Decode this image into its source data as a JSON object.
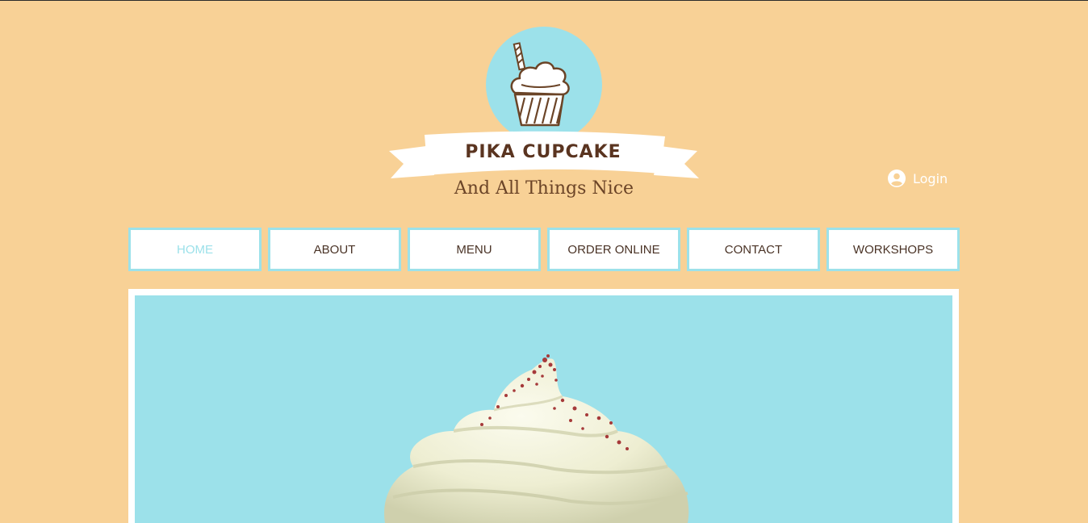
{
  "brand": {
    "title": "PIKA CUPCAKE",
    "tagline": "And All Things Nice"
  },
  "login": {
    "label": "Login",
    "icon": "user-circle-icon"
  },
  "nav": {
    "items": [
      {
        "label": "HOME",
        "active": true
      },
      {
        "label": "ABOUT",
        "active": false
      },
      {
        "label": "MENU",
        "active": false
      },
      {
        "label": "ORDER ONLINE",
        "active": false
      },
      {
        "label": "CONTACT",
        "active": false
      },
      {
        "label": "WORKSHOPS",
        "active": false
      }
    ]
  },
  "colors": {
    "background": "#f8d196",
    "accent": "#9ce1ea",
    "brand_text": "#5a3420",
    "nav_text": "#4a3326"
  }
}
